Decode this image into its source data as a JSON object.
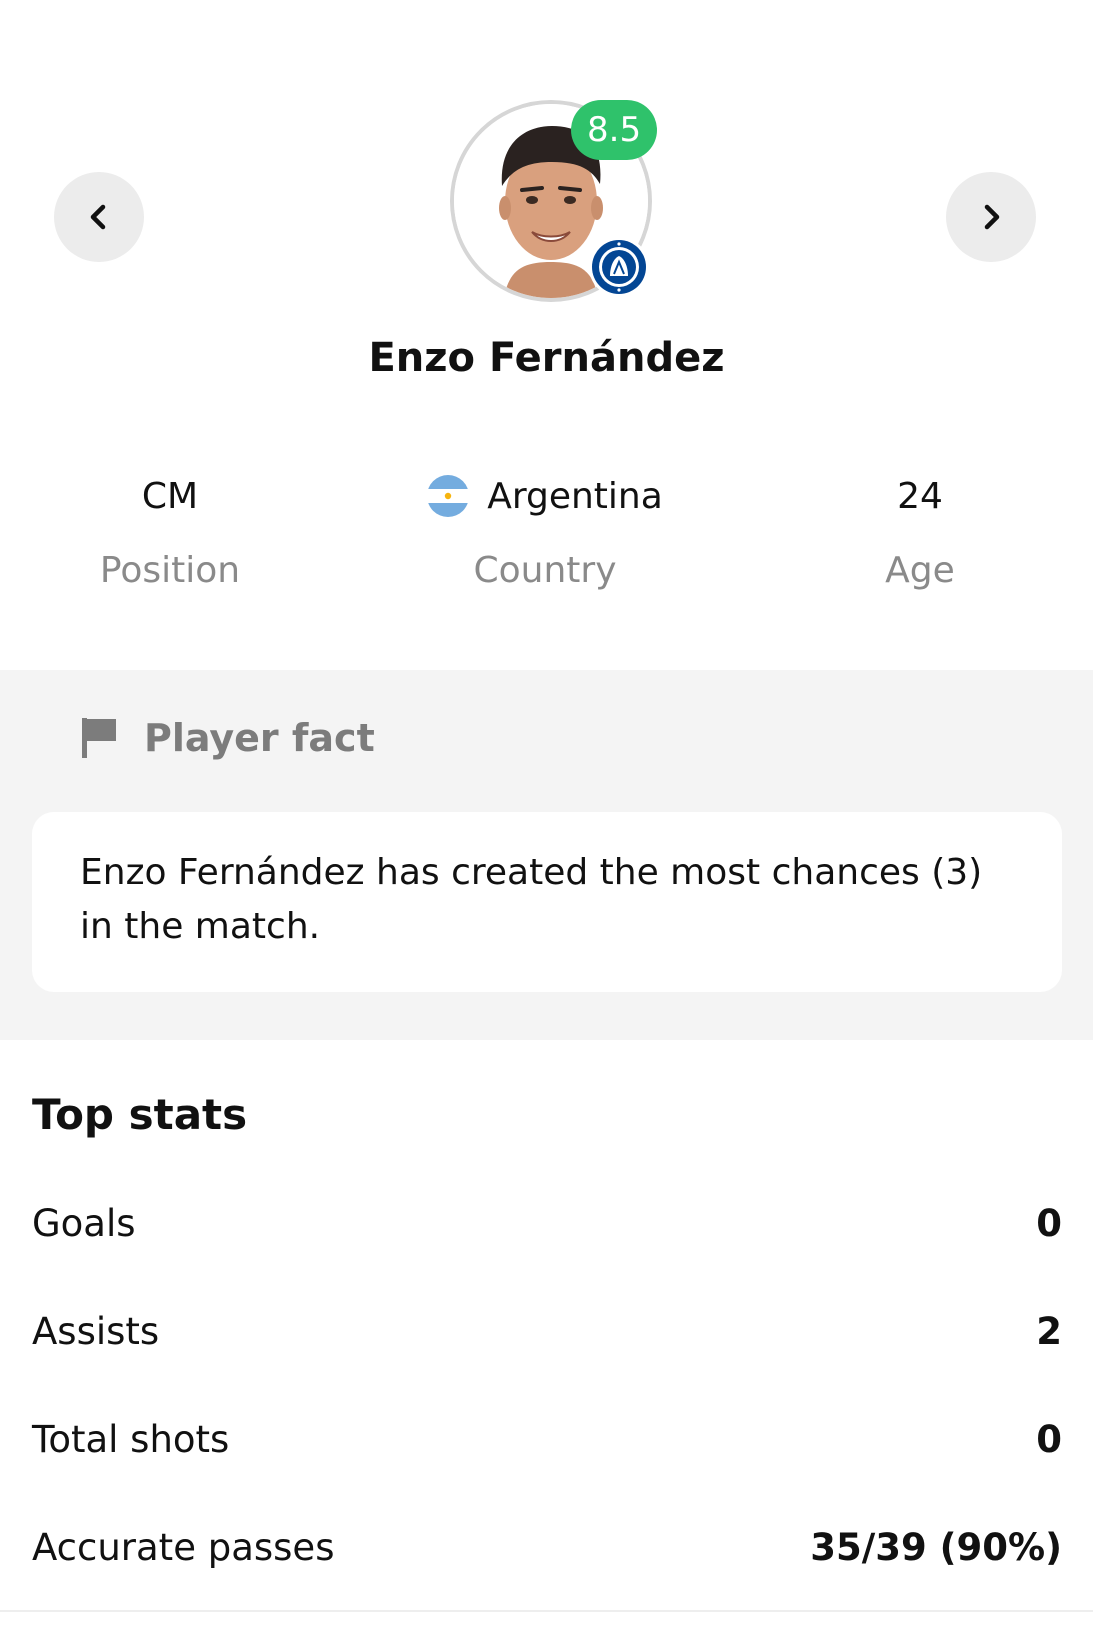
{
  "player": {
    "name": "Enzo Fernández",
    "rating": "8.5",
    "rating_color": "#2fc26b",
    "club_badge_icon": "chelsea-crest-icon"
  },
  "navigation": {
    "prev_icon": "chevron-left-icon",
    "next_icon": "chevron-right-icon"
  },
  "info": {
    "position": {
      "value": "CM",
      "label": "Position"
    },
    "country": {
      "value": "Argentina",
      "label": "Country",
      "flag_icon": "argentina-flag-icon"
    },
    "age": {
      "value": "24",
      "label": "Age"
    }
  },
  "fact": {
    "icon": "flag-icon",
    "title": "Player fact",
    "text": "Enzo Fernández has created the most chances (3) in the match."
  },
  "top_stats": {
    "title": "Top stats",
    "rows": [
      {
        "label": "Goals",
        "value": "0"
      },
      {
        "label": "Assists",
        "value": "2"
      },
      {
        "label": "Total shots",
        "value": "0"
      },
      {
        "label": "Accurate passes",
        "value": "35/39 (90%)"
      }
    ]
  }
}
